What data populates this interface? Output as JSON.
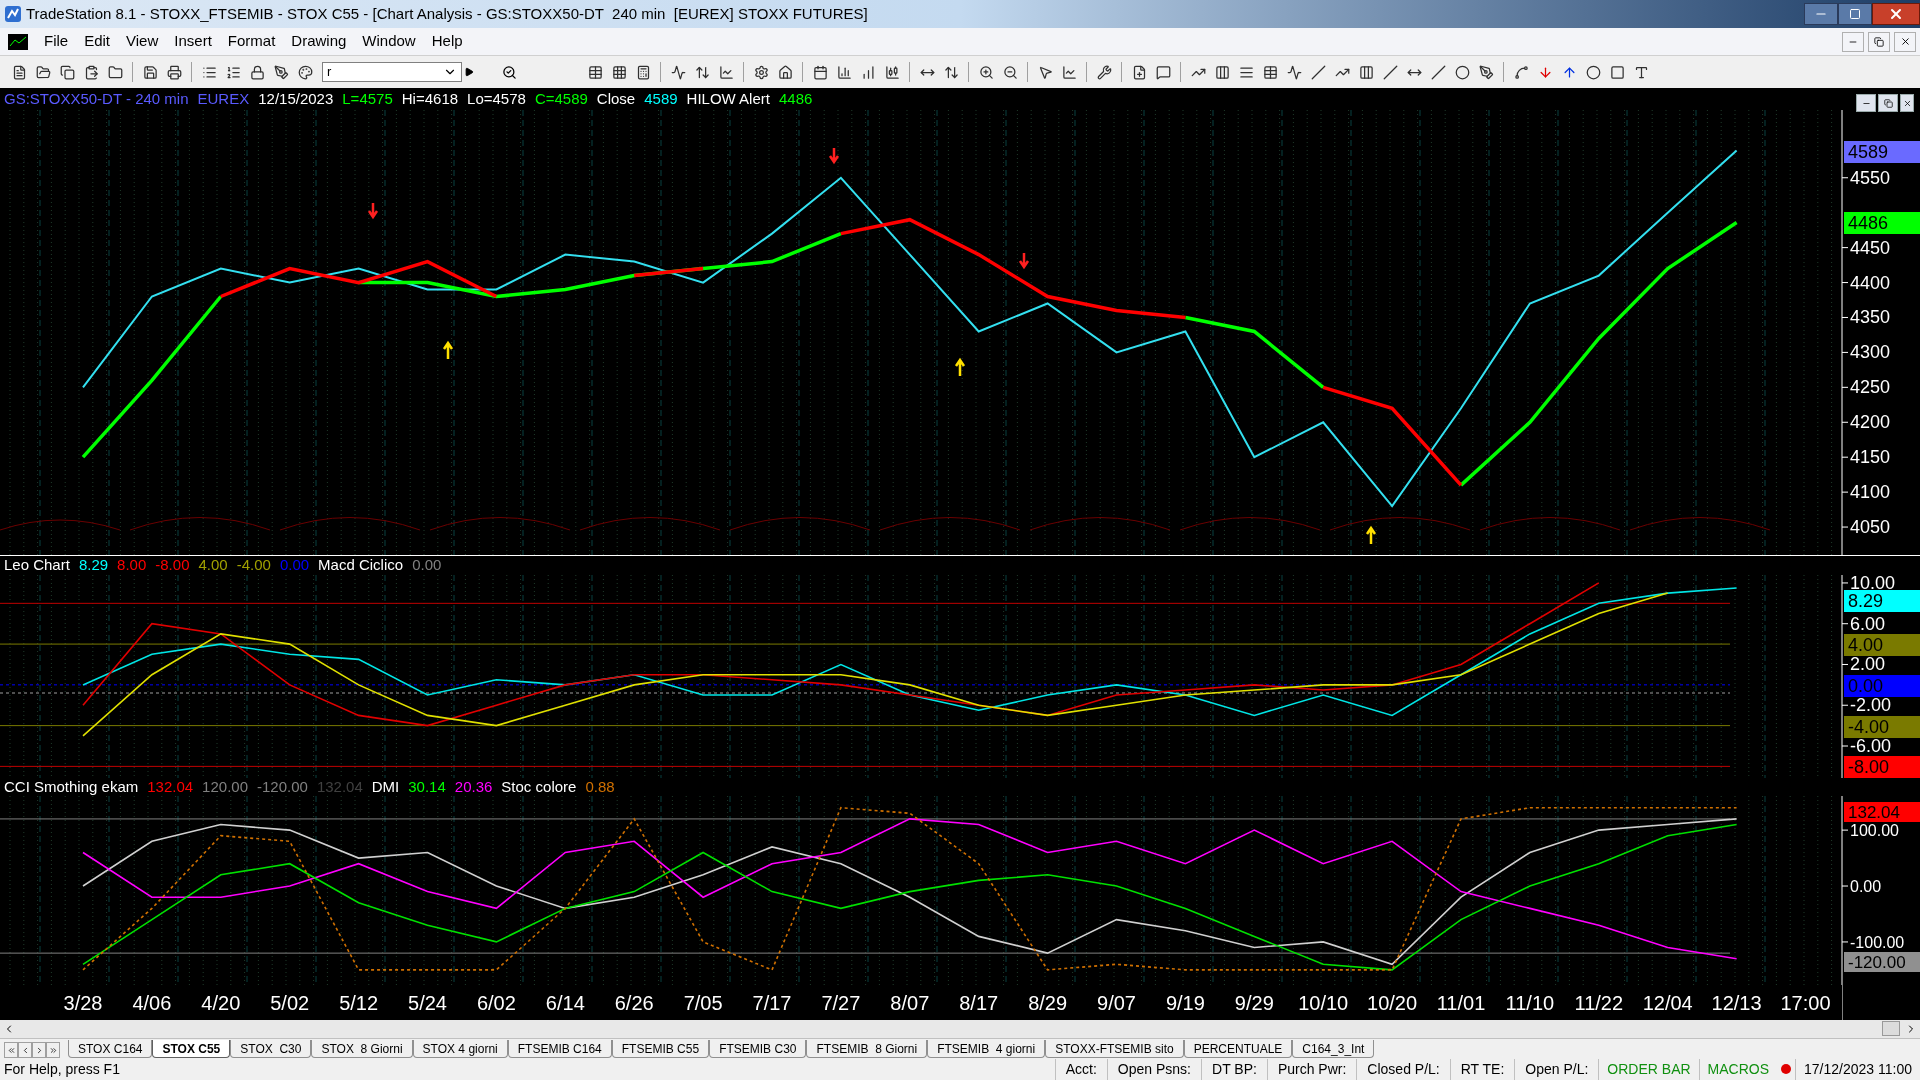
{
  "window": {
    "title": "TradeStation 8.1 - STOXX_FTSEMIB - STOX C55 - [Chart Analysis - GS:STOXX50-DT  240 min  [EUREX] STOXX FUTURES]"
  },
  "menu": [
    "File",
    "Edit",
    "View",
    "Insert",
    "Format",
    "Drawing",
    "Window",
    "Help"
  ],
  "toolbar": {
    "symbol_field": {
      "value": "r"
    }
  },
  "charts": [
    {
      "legend": [
        {
          "text": "GS:STOXX50-DT - 240 min",
          "color": "#5a5aff"
        },
        {
          "text": "EUREX",
          "color": "#5a5aff"
        },
        {
          "text": "12/15/2023",
          "color": "#ffffff"
        },
        {
          "text": "L=4575",
          "color": "#00ff00"
        },
        {
          "text": "Hi=4618",
          "color": "#ffffff"
        },
        {
          "text": "Lo=4578",
          "color": "#ffffff"
        },
        {
          "text": "C=4589",
          "color": "#00ff00"
        },
        {
          "text": "Close",
          "color": "#ffffff"
        },
        {
          "text": "4589",
          "color": "#00ffff"
        },
        {
          "text": "HILOW Alert",
          "color": "#ffffff"
        },
        {
          "text": "4486",
          "color": "#00ff00"
        }
      ],
      "value_boxes": [
        {
          "text": "4589",
          "color": "#6a6aff"
        },
        {
          "text": "4486",
          "color": "#00ff00"
        }
      ],
      "chart_data": {
        "type": "line",
        "grid": true,
        "categories": [
          null,
          null,
          null,
          null,
          null,
          null,
          null,
          null,
          null,
          null,
          null,
          null,
          null,
          null,
          null,
          null,
          null,
          null,
          null,
          null,
          null,
          null,
          null,
          null,
          null,
          null
        ],
        "ylim": [
          4010,
          4647
        ],
        "yticks": [
          {
            "value": 4550,
            "label": "4550"
          },
          {
            "value": 4450,
            "label": "4450"
          },
          {
            "value": 4400,
            "label": "4400"
          },
          {
            "value": 4350,
            "label": "4350"
          },
          {
            "value": 4300,
            "label": "4300"
          },
          {
            "value": 4250,
            "label": "4250"
          },
          {
            "value": 4200,
            "label": "4200"
          },
          {
            "value": 4150,
            "label": "4150"
          },
          {
            "value": 4100,
            "label": "4100"
          },
          {
            "value": 4050,
            "label": "4050"
          }
        ],
        "series": [
          {
            "color": "#33e0f0",
            "values": [
              4250,
              4380,
              4420,
              4400,
              4420,
              4390,
              4390,
              4440,
              4430,
              4400,
              4470,
              4550,
              4440,
              4330,
              4370,
              4300,
              4330,
              4150,
              4200,
              4080,
              4220,
              4370,
              4410,
              4500,
              4589,
              null
            ]
          },
          {
            "color": "#00ff00",
            "values": [
              4150,
              4260,
              4380,
              null,
              4400,
              4400,
              4380,
              4390,
              4410,
              4420,
              4430,
              4470,
              null,
              null,
              null,
              null,
              4350,
              4330,
              4250,
              null,
              4110,
              4200,
              4320,
              4420,
              4486,
              null
            ]
          },
          {
            "color": "#ff0000",
            "values": [
              null,
              null,
              4380,
              4420,
              4400,
              4430,
              4380,
              null,
              4410,
              4420,
              null,
              4470,
              4490,
              4440,
              4380,
              4360,
              4350,
              null,
              4250,
              4220,
              4110,
              null,
              null,
              null,
              null,
              null
            ]
          }
        ]
      }
    },
    {
      "legend": [
        {
          "text": "Leo Chart",
          "color": "#ffffff"
        },
        {
          "text": "8.29",
          "color": "#00ffff"
        },
        {
          "text": "8.00",
          "color": "#ff0000"
        },
        {
          "text": "-8.00",
          "color": "#ff0000"
        },
        {
          "text": "4.00",
          "color": "#a0a000"
        },
        {
          "text": "-4.00",
          "color": "#a0a000"
        },
        {
          "text": "0.00",
          "color": "#0000ff"
        },
        {
          "text": "Macd Ciclico",
          "color": "#ffffff"
        },
        {
          "text": "0.00",
          "color": "#808080"
        }
      ],
      "value_boxes": [
        {
          "text": "8.29",
          "color": "#00ffff"
        },
        {
          "text": "4.00",
          "color": "#7a7a00"
        },
        {
          "text": "0.00",
          "color": "#0000ff"
        },
        {
          "text": "-4.00",
          "color": "#7a7a00"
        },
        {
          "text": "-8.00",
          "color": "#ff0000"
        }
      ],
      "chart_data": {
        "type": "line",
        "grid": true,
        "categories": [
          null,
          null,
          null,
          null,
          null,
          null,
          null,
          null,
          null,
          null,
          null,
          null,
          null,
          null,
          null,
          null,
          null,
          null,
          null,
          null,
          null,
          null,
          null,
          null,
          null,
          null
        ],
        "ylim": [
          -9.14,
          10.78
        ],
        "yticks": [
          {
            "value": 10,
            "label": "10.00"
          },
          {
            "value": 6,
            "label": "6.00"
          },
          {
            "value": 2,
            "label": "2.00"
          },
          {
            "value": -2,
            "label": "-2.00"
          },
          {
            "value": -6,
            "label": "-6.00"
          }
        ],
        "ref_lines": [
          {
            "axis": "y",
            "value": 8,
            "color": "#c00000"
          },
          {
            "axis": "y",
            "value": 4,
            "color": "#7a7a00"
          },
          {
            "axis": "y",
            "value": 0,
            "color": "#0000ff"
          },
          {
            "axis": "y",
            "value": -0.8,
            "color": "#a0a0a0"
          },
          {
            "axis": "y",
            "value": -4,
            "color": "#7a7a00"
          },
          {
            "axis": "y",
            "value": -8,
            "color": "#c00000"
          }
        ],
        "series": [
          {
            "color": "#00e5e5",
            "values": [
              0,
              3,
              4,
              3,
              2.5,
              -1,
              0.5,
              0,
              1,
              -1,
              -1,
              2,
              -1,
              -2.5,
              -1,
              0,
              -1,
              -3,
              -1,
              -3,
              1,
              5,
              8,
              9,
              9.5,
              null
            ]
          },
          {
            "color": "#e00000",
            "values": [
              -2,
              6,
              5,
              0,
              -3,
              -4,
              -2,
              0,
              1,
              1,
              0.5,
              0,
              -1,
              -2,
              -3,
              -1,
              -0.5,
              0,
              -0.5,
              0,
              2,
              6,
              10,
              null,
              null,
              null
            ]
          },
          {
            "color": "#e0e000",
            "values": [
              -5,
              1,
              5,
              4,
              0,
              -3,
              -4,
              -2,
              0,
              1,
              1,
              1,
              0,
              -2,
              -3,
              -2,
              -1,
              -0.5,
              0,
              0,
              1,
              4,
              7,
              9,
              null,
              null
            ]
          }
        ]
      }
    },
    {
      "legend": [
        {
          "text": "CCI Smothing ekam",
          "color": "#ffffff"
        },
        {
          "text": "132.04",
          "color": "#ff0000"
        },
        {
          "text": "120.00",
          "color": "#808080"
        },
        {
          "text": "-120.00",
          "color": "#808080"
        },
        {
          "text": "132.04",
          "color": "#404040"
        },
        {
          "text": "DMI",
          "color": "#ffffff"
        },
        {
          "text": "30.14",
          "color": "#00ff00"
        },
        {
          "text": "20.36",
          "color": "#ff00ff"
        },
        {
          "text": "Stoc colore",
          "color": "#ffffff"
        },
        {
          "text": "0.88",
          "color": "#d07000"
        }
      ],
      "value_boxes": [
        {
          "text": "132.04",
          "color": "#ff0000"
        },
        {
          "text": "-120.00",
          "color": "#909090"
        }
      ],
      "chart_data": {
        "type": "line",
        "grid": true,
        "ylim": [
          -177,
          161
        ],
        "categories": [
          "3/28",
          "4/06",
          "4/20",
          "5/02",
          "5/12",
          "5/24",
          "6/02",
          "6/14",
          "6/26",
          "7/05",
          "7/17",
          "7/27",
          "8/07",
          "8/17",
          "8/29",
          "9/07",
          "9/19",
          "9/29",
          "10/10",
          "10/20",
          "11/01",
          "11/10",
          "11/22",
          "12/04",
          "12/13",
          "17:00"
        ],
        "yticks": [
          {
            "value": 100,
            "label": "100.00"
          },
          {
            "value": 0,
            "label": "0.00"
          },
          {
            "value": -100,
            "label": "-100.00"
          }
        ],
        "ref_lines": [
          {
            "axis": "y",
            "value": 120,
            "color": "#808080"
          },
          {
            "axis": "y",
            "value": -120,
            "color": "#808080"
          }
        ],
        "series": [
          {
            "color": "#d0d0d0",
            "values": [
              0,
              80,
              110,
              100,
              50,
              60,
              0,
              -40,
              -20,
              20,
              70,
              40,
              -20,
              -90,
              -120,
              -60,
              -80,
              -110,
              -100,
              -140,
              -20,
              60,
              100,
              110,
              120,
              null
            ]
          },
          {
            "color": "#ff00ff",
            "values": [
              60,
              -20,
              -20,
              0,
              40,
              -10,
              -40,
              60,
              80,
              -20,
              40,
              60,
              120,
              110,
              60,
              80,
              40,
              100,
              40,
              80,
              -10,
              -40,
              -70,
              -110,
              -130,
              null
            ]
          },
          {
            "color": "#00e000",
            "values": [
              -140,
              -60,
              20,
              40,
              -30,
              -70,
              -100,
              -40,
              -10,
              60,
              -10,
              -40,
              -10,
              10,
              20,
              0,
              -40,
              -90,
              -140,
              -150,
              -60,
              0,
              40,
              90,
              110,
              null
            ]
          },
          {
            "color": "#d07000",
            "line_style": "dashed",
            "values": [
              -150,
              -40,
              90,
              80,
              -150,
              -150,
              -150,
              -40,
              120,
              -100,
              -150,
              140,
              130,
              40,
              -150,
              -140,
              -150,
              -150,
              -150,
              -150,
              120,
              140,
              140,
              140,
              140,
              null
            ]
          }
        ]
      }
    }
  ],
  "tabs": [
    {
      "label": "STOX C164",
      "selected": false
    },
    {
      "label": "STOX C55",
      "selected": true
    },
    {
      "label": "STOX  C30",
      "selected": false
    },
    {
      "label": "STOX  8 Giorni",
      "selected": false
    },
    {
      "label": "STOX 4 giorni",
      "selected": false
    },
    {
      "label": "FTSEMIB C164",
      "selected": false
    },
    {
      "label": "FTSEMIB C55",
      "selected": false
    },
    {
      "label": "FTSEMIB C30",
      "selected": false
    },
    {
      "label": "FTSEMIB  8 Giorni",
      "selected": false
    },
    {
      "label": "FTSEMIB  4 giorni",
      "selected": false
    },
    {
      "label": "STOXX-FTSEMIB sito",
      "selected": false
    },
    {
      "label": "PERCENTUALE",
      "selected": false
    },
    {
      "label": "C164_3_Int",
      "selected": false
    }
  ],
  "status_bar": {
    "help": "For Help, press F1",
    "fields": [
      "Acct:",
      "Open Psns:",
      "DT BP:",
      "Purch Pwr:",
      "Closed P/L:",
      "RT TE:",
      "Open P/L:"
    ],
    "order_bar": "ORDER BAR",
    "macros": "MACROS",
    "datetime": "17/12/2023 11:00"
  }
}
